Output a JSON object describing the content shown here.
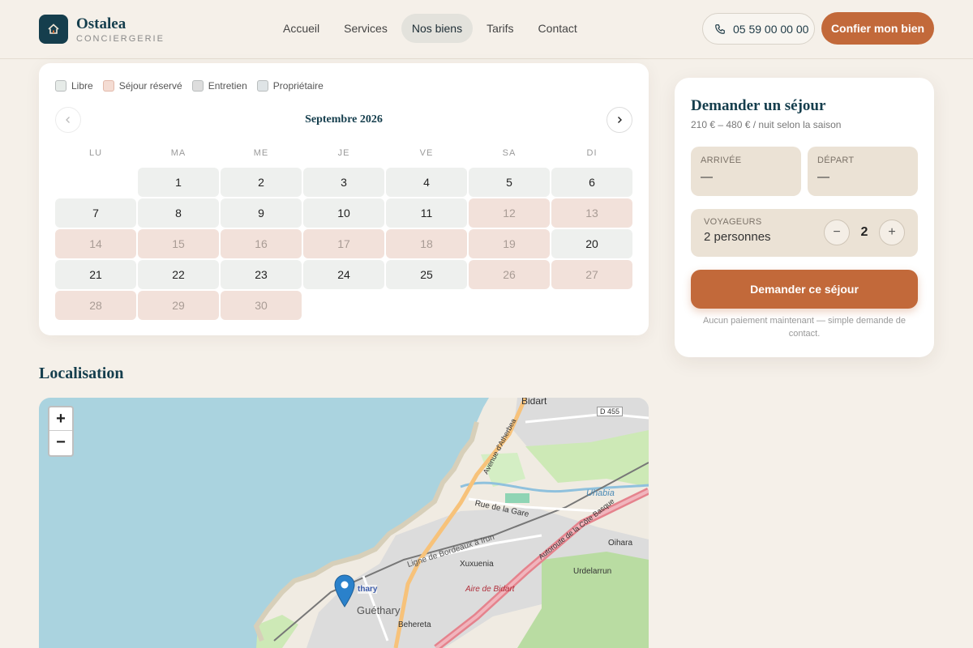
{
  "header": {
    "brand_name": "Ostalea",
    "brand_sub": "CONCIERGERIE",
    "nav": [
      {
        "label": "Accueil",
        "active": false
      },
      {
        "label": "Services",
        "active": false
      },
      {
        "label": "Nos biens",
        "active": true
      },
      {
        "label": "Tarifs",
        "active": false
      },
      {
        "label": "Contact",
        "active": false
      }
    ],
    "phone": "05 59 00 00 00",
    "cta": "Confier mon bien"
  },
  "calendar": {
    "legend": [
      {
        "label": "Libre",
        "color": "#e6ebe8"
      },
      {
        "label": "Séjour réservé",
        "color": "#f4dcd3"
      },
      {
        "label": "Entretien",
        "color": "#dddddd"
      },
      {
        "label": "Propriétaire",
        "color": "#dfe4e6"
      }
    ],
    "month": "Septembre 2026",
    "weekdays": [
      "LU",
      "MA",
      "ME",
      "JE",
      "VE",
      "SA",
      "DI"
    ],
    "first_weekday_offset": 1,
    "days": [
      {
        "d": "1",
        "s": "free"
      },
      {
        "d": "2",
        "s": "free"
      },
      {
        "d": "3",
        "s": "free"
      },
      {
        "d": "4",
        "s": "free"
      },
      {
        "d": "5",
        "s": "free"
      },
      {
        "d": "6",
        "s": "free"
      },
      {
        "d": "7",
        "s": "free"
      },
      {
        "d": "8",
        "s": "free"
      },
      {
        "d": "9",
        "s": "free"
      },
      {
        "d": "10",
        "s": "free"
      },
      {
        "d": "11",
        "s": "free"
      },
      {
        "d": "12",
        "s": "booked"
      },
      {
        "d": "13",
        "s": "booked"
      },
      {
        "d": "14",
        "s": "booked"
      },
      {
        "d": "15",
        "s": "booked"
      },
      {
        "d": "16",
        "s": "booked"
      },
      {
        "d": "17",
        "s": "booked"
      },
      {
        "d": "18",
        "s": "booked"
      },
      {
        "d": "19",
        "s": "booked"
      },
      {
        "d": "20",
        "s": "free"
      },
      {
        "d": "21",
        "s": "free"
      },
      {
        "d": "22",
        "s": "free"
      },
      {
        "d": "23",
        "s": "free"
      },
      {
        "d": "24",
        "s": "free"
      },
      {
        "d": "25",
        "s": "free"
      },
      {
        "d": "26",
        "s": "booked"
      },
      {
        "d": "27",
        "s": "booked"
      },
      {
        "d": "28",
        "s": "booked"
      },
      {
        "d": "29",
        "s": "booked"
      },
      {
        "d": "30",
        "s": "booked"
      }
    ]
  },
  "booking": {
    "title": "Demander un séjour",
    "price": "210 € – 480 € / nuit selon la saison",
    "arrival_label": "ARRIVÉE",
    "arrival_value": "—",
    "departure_label": "DÉPART",
    "departure_value": "—",
    "guests_label": "VOYAGEURS",
    "guests_text": "2 personnes",
    "guests_count": "2",
    "minus": "−",
    "plus": "+",
    "submit": "Demander ce séjour",
    "note": "Aucun paiement maintenant — simple demande de contact."
  },
  "location": {
    "title": "Localisation",
    "zoom_in": "+",
    "zoom_out": "−",
    "map_labels": [
      "Bidart",
      "D 455",
      "Avenue d'Atherbea",
      "Uhabia",
      "Rue de la Gare",
      "Autoroute de la Côte Basque",
      "Ligne de Bordeaux à Irun",
      "Oihara",
      "Xuxuenia",
      "Urdelarrun",
      "Aire de Bidart",
      "Guéthary",
      "Behereta",
      "thary"
    ]
  }
}
